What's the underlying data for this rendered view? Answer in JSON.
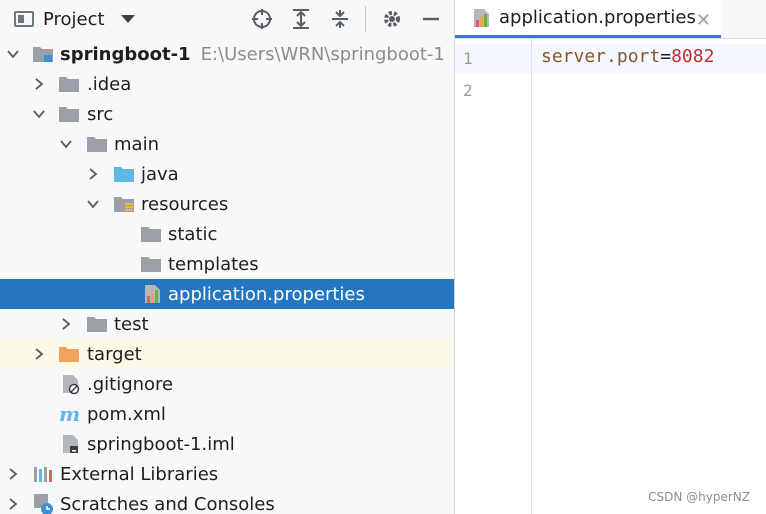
{
  "project_panel": {
    "title": "Project",
    "tree": [
      {
        "label": "springboot-1",
        "path": "E:\\Users\\WRN\\springboot-1"
      },
      {
        "label": ".idea"
      },
      {
        "label": "src"
      },
      {
        "label": "main"
      },
      {
        "label": "java"
      },
      {
        "label": "resources"
      },
      {
        "label": "static"
      },
      {
        "label": "templates"
      },
      {
        "label": "application.properties"
      },
      {
        "label": "test"
      },
      {
        "label": "target"
      },
      {
        "label": ".gitignore"
      },
      {
        "label": "pom.xml"
      },
      {
        "label": "springboot-1.iml"
      },
      {
        "label": "External Libraries"
      },
      {
        "label": "Scratches and Consoles"
      }
    ]
  },
  "editor": {
    "tab_label": "application.properties",
    "close_glyph": "✕",
    "line_numbers": [
      "1",
      "2"
    ],
    "code": {
      "key": "server.port",
      "eq": "=",
      "value": "8082"
    }
  },
  "watermark": "CSDN @hyperNZ",
  "colors": {
    "selection": "#2675bf",
    "highlight": "#fcfae6",
    "folder": "#9aa0a6",
    "source_folder": "#5fb8e6",
    "target_folder": "#f0a35e"
  }
}
